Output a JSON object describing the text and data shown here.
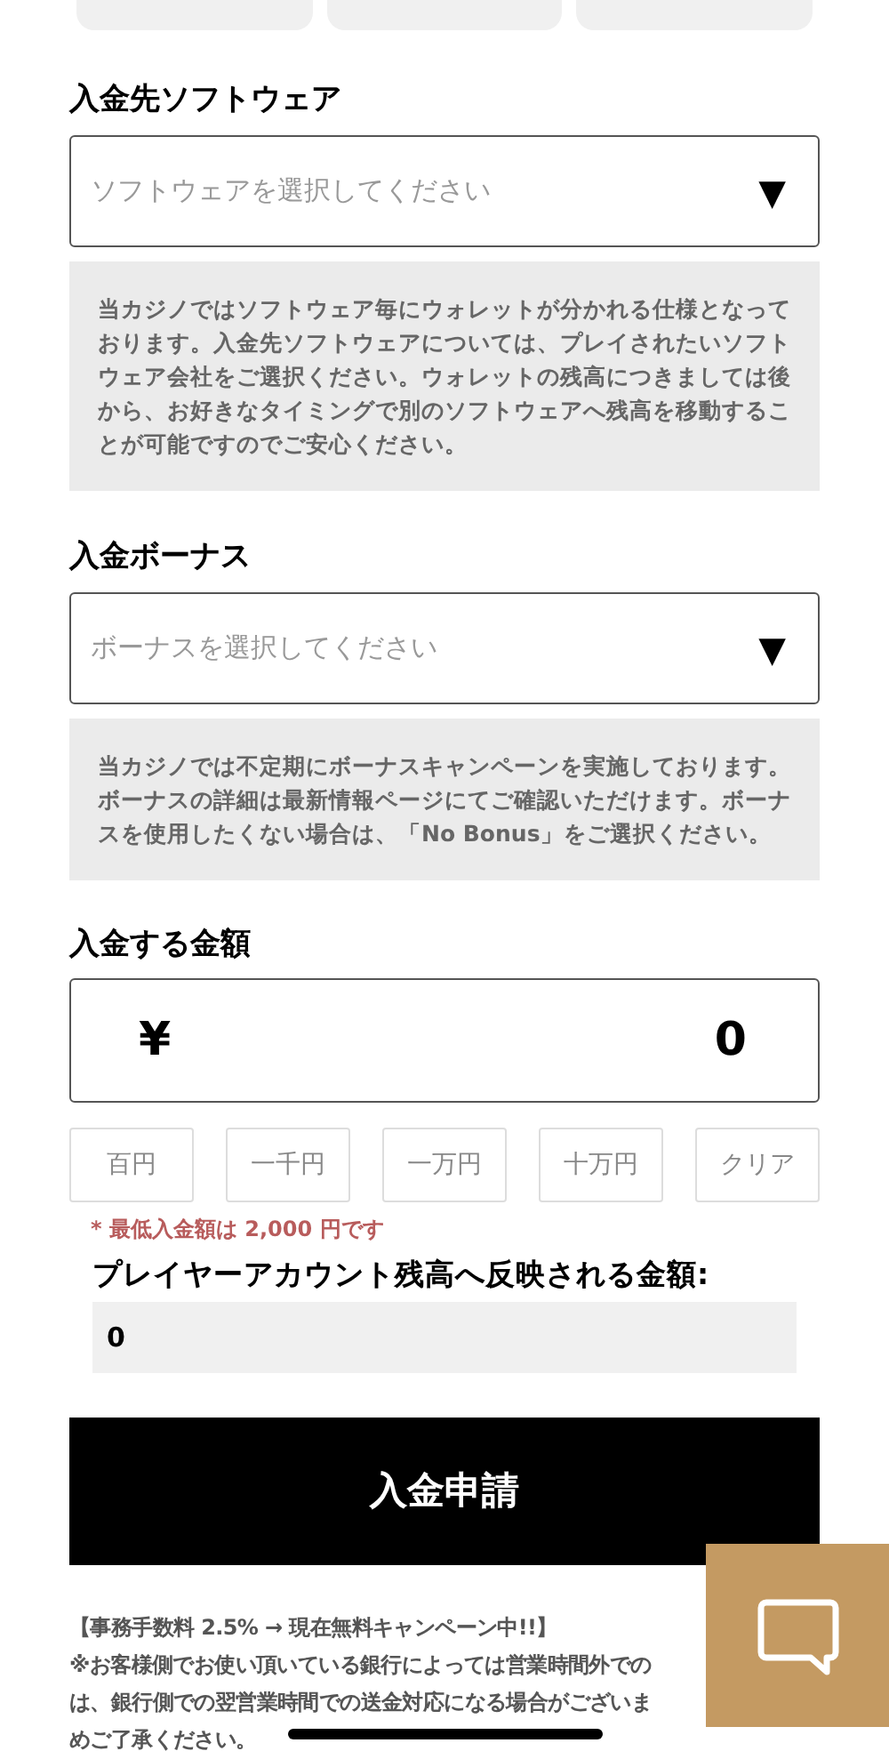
{
  "top_cards": [
    {
      "kind": "card"
    },
    {
      "kind": "card"
    },
    {
      "kind": "card"
    }
  ],
  "software": {
    "label": "入金先ソフトウェア",
    "placeholder": "ソフトウェアを選択してください",
    "arrow": "▼",
    "info": "当カジノではソフトウェア毎にウォレットが分かれる仕様となっております。入金先ソフトウェアについては、プレイされたいソフトウェア会社をご選択ください。ウォレットの残高につきましては後から、お好きなタイミングで別のソフトウェアへ残高を移動することが可能ですのでご安心ください。"
  },
  "bonus": {
    "label": "入金ボーナス",
    "placeholder": "ボーナスを選択してください",
    "arrow": "▼",
    "info": "当カジノでは不定期にボーナスキャンペーンを実施しております。ボーナスの詳細は最新情報ページにてご確認いただけます。ボーナスを使用したくない場合は、「No Bonus」をご選択ください。"
  },
  "amount": {
    "label": "入金する金額",
    "currency": "¥",
    "value": "0",
    "quick_buttons": [
      "百円",
      "一千円",
      "一万円",
      "十万円",
      "クリア"
    ],
    "minimum_note": "* 最低入金額は 2,000 円です",
    "reflected_label": "プレイヤーアカウント残高へ反映される金額:",
    "reflected_value": "0"
  },
  "submit_button": "入金申請",
  "notes": [
    "【事務手数料 2.5% → 現在無料キャンペーン中!!】",
    "※お客様側でお使い頂いている銀行によっては営業時間外での",
    "は、銀行側での翌営業時間での送金対応になる場合がございま",
    "めご了承ください。"
  ]
}
